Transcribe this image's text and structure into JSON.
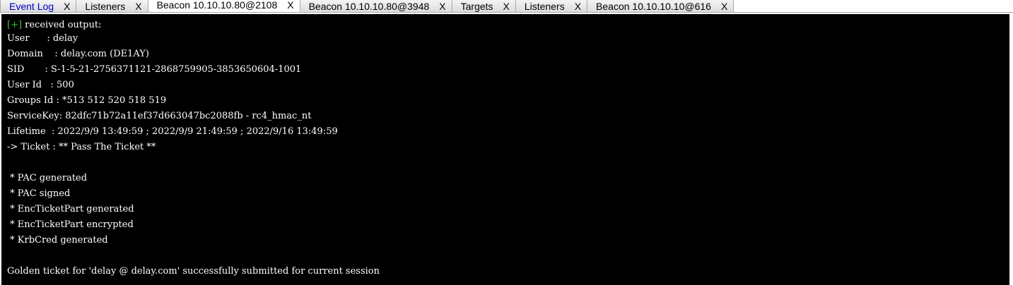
{
  "tabs": [
    {
      "label": "Event Log",
      "close": "X",
      "highlight": true,
      "active": false
    },
    {
      "label": "Listeners",
      "close": "X",
      "highlight": false,
      "active": false
    },
    {
      "label": "Beacon 10.10.10.80@2108",
      "close": "X",
      "highlight": false,
      "active": true
    },
    {
      "label": "Beacon 10.10.10.80@3948",
      "close": "X",
      "highlight": false,
      "active": false
    },
    {
      "label": "Targets",
      "close": "X",
      "highlight": false,
      "active": false
    },
    {
      "label": "Listeners",
      "close": "X",
      "highlight": false,
      "active": false
    },
    {
      "label": "Beacon 10.10.10.10@616",
      "close": "X",
      "highlight": false,
      "active": false
    }
  ],
  "console": {
    "prefix": "[+]",
    "header_text": " received output:",
    "lines": [
      "User      : delay",
      "Domain    : delay.com (DE1AY)",
      "SID       : S-1-5-21-2756371121-2868759905-3853650604-1001",
      "User Id   : 500",
      "Groups Id : *513 512 520 518 519",
      "ServiceKey: 82dfc71b72a11ef37d663047bc2088fb - rc4_hmac_nt",
      "Lifetime  : 2022/9/9 13:49:59 ; 2022/9/9 21:49:59 ; 2022/9/16 13:49:59",
      "-> Ticket : ** Pass The Ticket **",
      "",
      " * PAC generated",
      " * PAC signed",
      " * EncTicketPart generated",
      " * EncTicketPart encrypted",
      " * KrbCred generated",
      "",
      "Golden ticket for 'delay @ delay.com' successfully submitted for current session"
    ]
  },
  "colors": {
    "console_background": "#000000",
    "console_text": "#ffffff",
    "success_prefix": "#33cc33",
    "highlight_tab": "#0000cc"
  }
}
